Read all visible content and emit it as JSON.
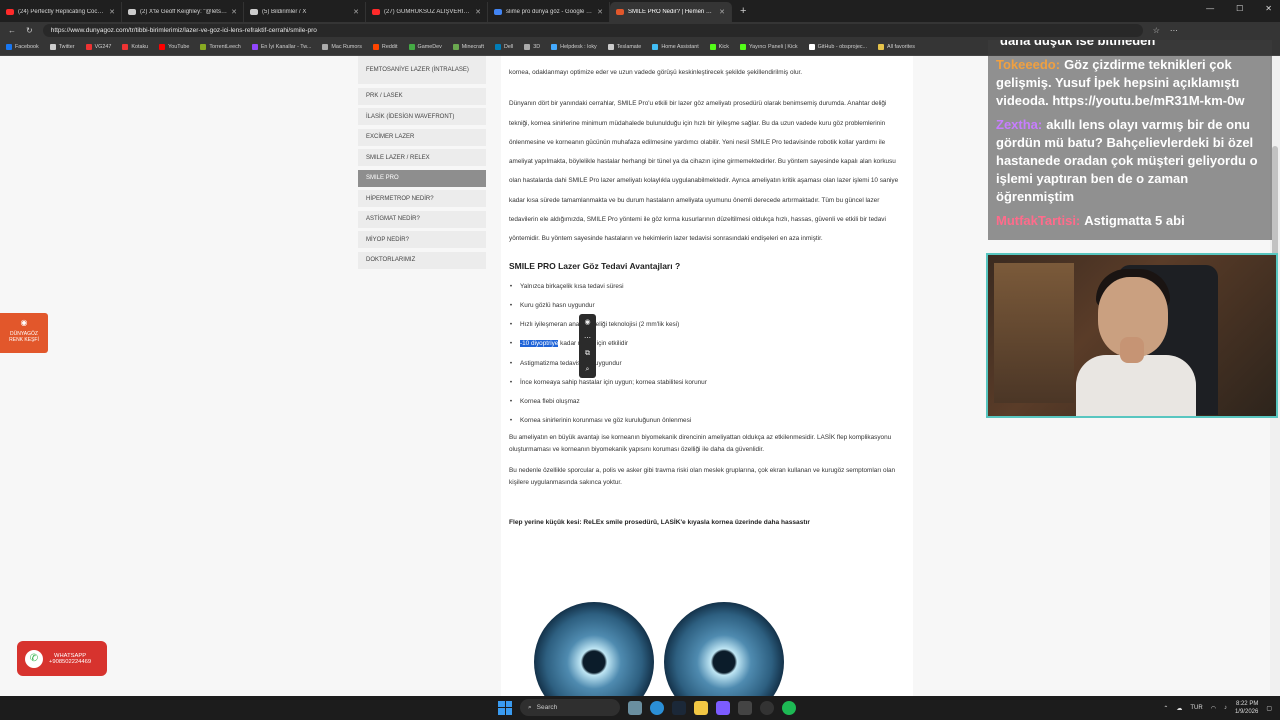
{
  "tabs": [
    {
      "label": "(24) Perfectly Replicating Coca Cola",
      "color": "#ff2a2a"
    },
    {
      "label": "(2) X'te Geoff Keighley: \"@letsers",
      "color": "#cccccc"
    },
    {
      "label": "(5) Bildirimler / X",
      "color": "#cccccc"
    },
    {
      "label": "(27) GÜMRÜKSÜZ ALIŞVERİŞ DEV",
      "color": "#ff2a2a"
    },
    {
      "label": "slime pro dünya göz - Google Sea",
      "color": "#4285f4"
    },
    {
      "label": "SMILE PRO Nedir? | Hemen Randu",
      "color": "#e2572b",
      "active": true
    }
  ],
  "new_tab_icon": "plus-icon",
  "address": {
    "url": "https://www.dunyagoz.com/tr/tibbi-birimlerimiz/lazer-ve-goz-ici-lens-refraktif-cerrahi/smile-pro"
  },
  "bookmarks": [
    {
      "label": "Facebook",
      "color": "#1877f2"
    },
    {
      "label": "Twitter",
      "color": "#cccccc"
    },
    {
      "label": "VG247",
      "color": "#e33"
    },
    {
      "label": "Kotaku",
      "color": "#e33"
    },
    {
      "label": "YouTube",
      "color": "#ff0000"
    },
    {
      "label": "TorrentLeech",
      "color": "#88aa22"
    },
    {
      "label": "En İyi Kanallar - Tw...",
      "color": "#9146ff"
    },
    {
      "label": "Mac Rumors",
      "color": "#aaaaaa"
    },
    {
      "label": "Reddit",
      "color": "#ff4500"
    },
    {
      "label": "GameDev",
      "color": "#44aa44"
    },
    {
      "label": "Minecraft",
      "color": "#6aa84f"
    },
    {
      "label": "Dell",
      "color": "#007db8"
    },
    {
      "label": "3D",
      "color": "#aaaaaa"
    },
    {
      "label": "Helpdesk : loky",
      "color": "#44aaff"
    },
    {
      "label": "Teslamate",
      "color": "#cccccc"
    },
    {
      "label": "Home Assistant",
      "color": "#41bdf5"
    },
    {
      "label": "Kick",
      "color": "#53fc18"
    },
    {
      "label": "Yayıncı Paneli | Kick",
      "color": "#53fc18"
    },
    {
      "label": "GitHub - obsprojec...",
      "color": "#ffffff"
    },
    {
      "label": "All favorites",
      "color": "#e6c34a"
    }
  ],
  "sidebar": {
    "items": [
      {
        "label": "FEMTOSANİYE LAZER (İNTRALASE)"
      },
      {
        "label": "PRK / LASEK"
      },
      {
        "label": "İLASİK (İDESİGN WAVEFRONT)"
      },
      {
        "label": "EXCİMER LAZER"
      },
      {
        "label": "SMILE LAZER / RELEX"
      },
      {
        "label": "SMILE PRO",
        "active": true
      },
      {
        "label": "HİPERMETROP NEDİR?"
      },
      {
        "label": "ASTİGMAT NEDİR?"
      },
      {
        "label": "MİYOP NEDİR?"
      },
      {
        "label": "DOKTORLARIMIZ"
      }
    ]
  },
  "article": {
    "intro_end": "kornea, odaklanmayı optimize eder ve uzun vadede görüşü keskinleştirecek şekilde şekillendirilmiş olur.",
    "para1": "Dünyanın dört bir yanındaki cerrahlar, SMILE Pro'u etkili bir lazer göz ameliyatı prosedürü olarak benimsemiş durumda. Anahtar deliği tekniği, kornea sinirlerine minimum müdahalede bulunulduğu için hızlı bir iyileşme sağlar. Bu da uzun vadede kuru göz problemlerinin önlenmesine ve korneanın gücünün muhafaza edilmesine yardımcı olabilir. Yeni nesil SMILE Pro tedavisinde robotik kollar yardımı ile ameliyat yapılmakta, böylelikle hastalar herhangi bir tünel ya da cihazın içine girmemektedirler. Bu yöntem sayesinde kapalı alan korkusu olan hastalarda dahi SMILE Pro lazer ameliyatı kolaylıkla uygulanabilmektedir. Ayrıca ameliyatın kritik aşaması olan lazer işlemi 10 saniye kadar kısa sürede tamamlanmakta ve bu durum hastaların ameliyata uyumunu önemli derecede artırmaktadır. Tüm bu güncel lazer tedavilerin ele aldığımızda, SMILE Pro yöntemi ile göz kırma kusurlarının düzeltilmesi oldukça hızlı, hassas, güvenli ve etkili bir tedavi yöntemidir. Bu yöntem sayesinde hastaların ve hekimlerin lazer tedavisi sonrasındaki endişeleri en aza inmiştir.",
    "heading": "SMILE PRO Lazer Göz Tedavi Avantajları ?",
    "bullets": [
      {
        "pre": "Yalnızca birkaç",
        "hl": "",
        "post": "elik kısa tedavi süresi"
      },
      {
        "pre": "Kuru gözlü has",
        "hl": "",
        "post": "n uygundur"
      },
      {
        "pre": "Hızlı iyileşme",
        "hl": "",
        "post": "ran anahtar deliği teknolojisi (2 mm'lik kesi)"
      },
      {
        "pre": "",
        "hl": "-10 diyoptriye",
        "post": " kadar miyop için etkilidir"
      },
      {
        "pre": "Astigmatizma tedavisi için uygundur",
        "hl": "",
        "post": ""
      },
      {
        "pre": "İnce korneaya sahip hastalar için uygun; kornea stabilitesi korunur",
        "hl": "",
        "post": ""
      },
      {
        "pre": "Kornea flebi oluşmaz",
        "hl": "",
        "post": ""
      },
      {
        "pre": "Kornea sinirlerinin korunması ve göz kuruluğunun önlenmesi",
        "hl": "",
        "post": ""
      }
    ],
    "para2": "Bu ameliyatın en büyük avantajı ise korneanın biyomekanik direncinin ameliyattan oldukça az etkilenmesidir. LASİK flep komplikasyonu oluşturmaması ve korneanın biyomekanik yapısını koruması özelliği ile daha da güvenlidir.",
    "para3": "Bu nedenle özellikle sporcular a, polis ve asker gibi travma riski olan meslek gruplarına, çok ekran kullanan ve kurugöz semptomları olan kişilere uygulanmasında sakınca yoktur.",
    "subheading": "Flep yerine küçük kesi: ReLEx smile prosedürü, LASİK'e kıyasla kornea üzerinde daha hassastır"
  },
  "left_badge": {
    "line1": "DÜNYAGÖZ",
    "line2": "RENK KEŞFİ"
  },
  "whatsapp": {
    "label": "WHATSAPP",
    "phone": "+908502224469"
  },
  "chat": {
    "messages": [
      {
        "user": "",
        "user_color": "#ffffff",
        "text": "daha düşük ise bitmeden"
      },
      {
        "user": "Tokeeedo:",
        "user_color": "#f0a040",
        "text": "Göz çizdirme teknikleri çok gelişmiş. Yusuf İpek hepsini açıklamıştı videoda. https://youtu.be/mR31M-km-0w"
      },
      {
        "user": "Zextha:",
        "user_color": "#c77dff",
        "text": "akıllı lens olayı varmış bir de onu gördün mü batu? Bahçelievlerdeki bi özel hastanede oradan çok müşteri geliyordu o işlemi yaptıran ben de o zaman öğrenmiştim"
      },
      {
        "user": "MutfakTartisi:",
        "user_color": "#ff6b8b",
        "text": "Astigmatta 5 abi"
      }
    ]
  },
  "taskbar": {
    "search_placeholder": "Search",
    "lang": "TUR",
    "time": "8:22 PM",
    "date": "1/9/2026"
  }
}
